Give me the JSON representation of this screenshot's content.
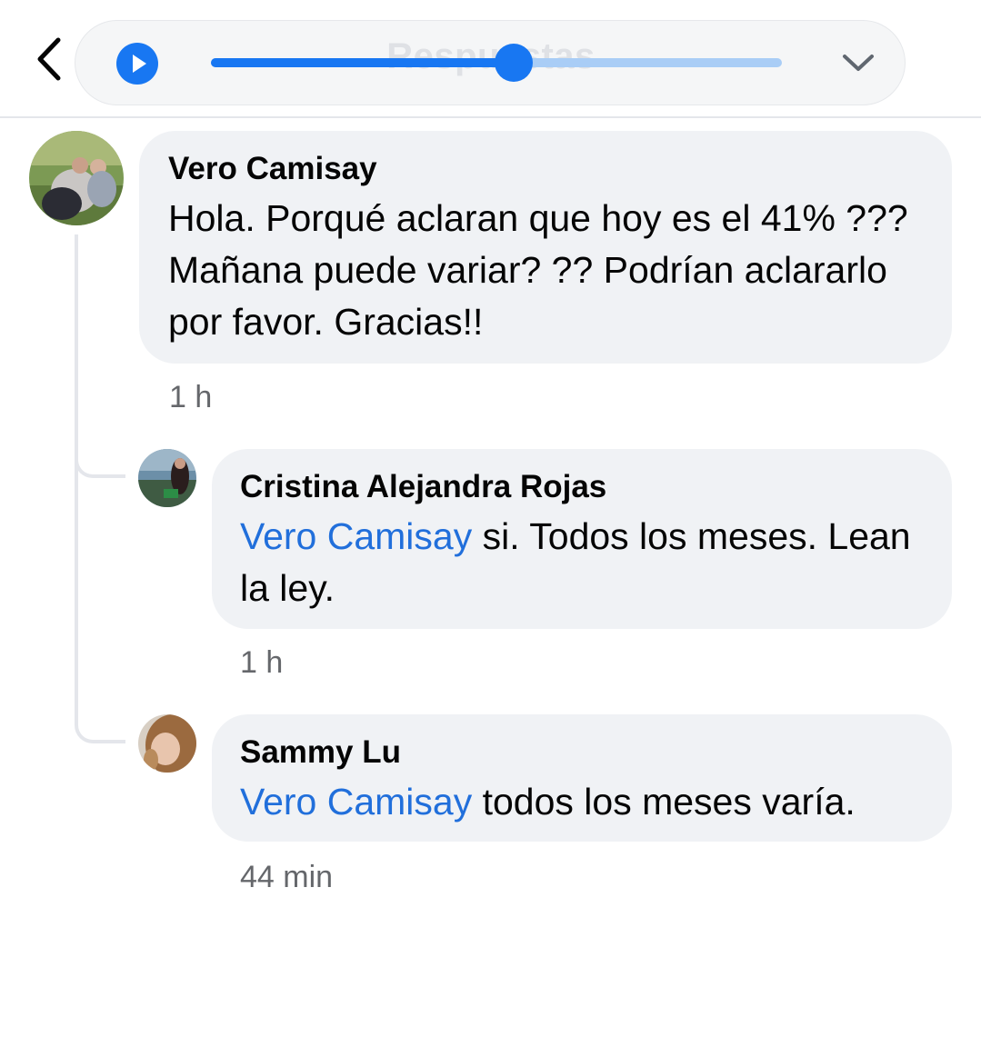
{
  "header": {
    "title": "Respuestas",
    "back_icon": "chevron-left-icon",
    "play_icon": "play-icon",
    "dropdown_icon": "chevron-down-icon",
    "progress_fraction": 0.53,
    "accent_color": "#1877f2"
  },
  "comments": [
    {
      "author": "Vero Camisay",
      "mention": "",
      "text": "Hola. Porqué aclaran que hoy es el 41% ??? Mañana puede variar? ?? Podrían aclararlo por favor. Gracias!!",
      "time": "1 h"
    },
    {
      "author": "Cristina Alejandra Rojas",
      "mention": "Vero Camisay",
      "text": " si. Todos los meses. Lean la ley.",
      "time": "1 h"
    },
    {
      "author": "Sammy Lu",
      "mention": "Vero Camisay",
      "text": " todos los meses varía.",
      "time": "44 min"
    }
  ]
}
